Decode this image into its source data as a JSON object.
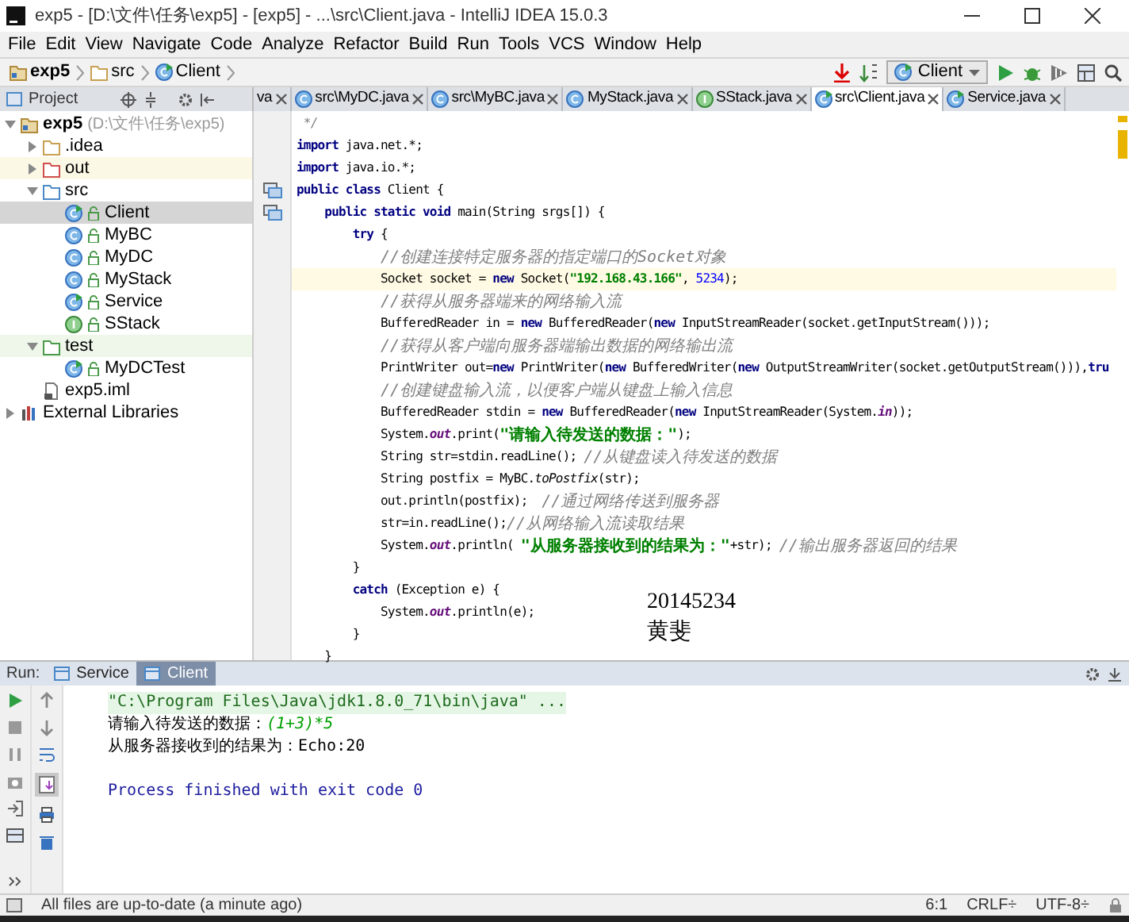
{
  "window": {
    "title": "exp5 - [D:\\文件\\任务\\exp5] - [exp5] - ...\\src\\Client.java - IntelliJ IDEA 15.0.3"
  },
  "menu": [
    "File",
    "Edit",
    "View",
    "Navigate",
    "Code",
    "Analyze",
    "Refactor",
    "Build",
    "Run",
    "Tools",
    "VCS",
    "Window",
    "Help"
  ],
  "breadcrumb": [
    {
      "label": "exp5",
      "kind": "module"
    },
    {
      "label": "src",
      "kind": "folder"
    },
    {
      "label": "Client",
      "kind": "runnable"
    }
  ],
  "run_config": {
    "label": "Client"
  },
  "project_panel": {
    "title": "Project"
  },
  "tabs": [
    {
      "label": "va",
      "selected": false
    },
    {
      "label": "src\\MyDC.java",
      "kind": "class",
      "selected": false
    },
    {
      "label": "src\\MyBC.java",
      "kind": "class",
      "selected": false
    },
    {
      "label": "MyStack.java",
      "kind": "class",
      "selected": false
    },
    {
      "label": "SStack.java",
      "kind": "interface",
      "selected": false
    },
    {
      "label": "src\\Client.java",
      "kind": "runnable",
      "selected": true
    },
    {
      "label": "Service.java",
      "kind": "runnable",
      "selected": false
    }
  ],
  "tree": [
    {
      "label": "exp5",
      "path": "(D:\\文件\\任务\\exp5)",
      "kind": "module",
      "expanded": true,
      "selected": false,
      "children": [
        {
          "label": ".idea",
          "kind": "folder",
          "expanded": false,
          "selected": false
        },
        {
          "label": "out",
          "kind": "excluded",
          "expanded": false,
          "selected": false
        },
        {
          "label": "src",
          "kind": "source",
          "expanded": true,
          "selected": false,
          "children": [
            {
              "label": "Client",
              "kind": "runnable",
              "selected": true
            },
            {
              "label": "MyBC",
              "kind": "class",
              "selected": false
            },
            {
              "label": "MyDC",
              "kind": "class",
              "selected": false
            },
            {
              "label": "MyStack",
              "kind": "class",
              "selected": false
            },
            {
              "label": "Service",
              "kind": "runnable",
              "selected": false
            },
            {
              "label": "SStack",
              "kind": "interface",
              "selected": false
            }
          ]
        },
        {
          "label": "test",
          "kind": "test",
          "expanded": true,
          "selected": false,
          "children": [
            {
              "label": "MyDCTest",
              "kind": "runnable",
              "selected": false
            }
          ]
        },
        {
          "label": "exp5.iml",
          "kind": "file",
          "selected": false
        }
      ]
    },
    {
      "label": "External Libraries",
      "kind": "libraries",
      "expanded": false,
      "selected": false
    }
  ],
  "code": [
    {
      "current": false,
      "tokens": [
        {
          "text": " */",
          "kind": "comment"
        }
      ]
    },
    {
      "current": false,
      "tokens": [
        {
          "text": "import",
          "kind": "keyword"
        },
        {
          "text": " java.net.*;",
          "kind": "plain"
        }
      ]
    },
    {
      "current": false,
      "tokens": [
        {
          "text": "import",
          "kind": "keyword"
        },
        {
          "text": " java.io.*;",
          "kind": "plain"
        }
      ]
    },
    {
      "current": false,
      "marker": true,
      "tokens": [
        {
          "text": "public class",
          "kind": "keyword"
        },
        {
          "text": " Client {",
          "kind": "plain"
        }
      ]
    },
    {
      "current": false,
      "marker": true,
      "tokens": [
        {
          "text": "    public static void",
          "kind": "keyword"
        },
        {
          "text": " main(String srgs[]) {",
          "kind": "plain"
        }
      ]
    },
    {
      "current": false,
      "tokens": [
        {
          "text": "        try",
          "kind": "keyword"
        },
        {
          "text": " {",
          "kind": "plain"
        }
      ]
    },
    {
      "current": false,
      "tokens": [
        {
          "text": "            //创建连接特定服务器的指定端口的Socket对象",
          "kind": "comment"
        }
      ]
    },
    {
      "current": true,
      "tokens": [
        {
          "text": "            Socket socket = ",
          "kind": "plain"
        },
        {
          "text": "new",
          "kind": "keyword"
        },
        {
          "text": " Socket(",
          "kind": "plain"
        },
        {
          "text": "\"192.168.43.166\"",
          "kind": "string"
        },
        {
          "text": ", ",
          "kind": "plain"
        },
        {
          "text": "5234",
          "kind": "number"
        },
        {
          "text": ");",
          "kind": "plain"
        }
      ]
    },
    {
      "current": false,
      "tokens": [
        {
          "text": "            //获得从服务器端来的网络输入流",
          "kind": "comment"
        }
      ]
    },
    {
      "current": false,
      "tokens": [
        {
          "text": "            BufferedReader in = ",
          "kind": "plain"
        },
        {
          "text": "new",
          "kind": "keyword"
        },
        {
          "text": " BufferedReader(",
          "kind": "plain"
        },
        {
          "text": "new",
          "kind": "keyword"
        },
        {
          "text": " InputStreamReader(socket.getInputStream()));",
          "kind": "plain"
        }
      ]
    },
    {
      "current": false,
      "tokens": [
        {
          "text": "            //获得从客户端向服务器端输出数据的网络输出流",
          "kind": "comment"
        }
      ]
    },
    {
      "current": false,
      "tokens": [
        {
          "text": "            PrintWriter out=",
          "kind": "plain"
        },
        {
          "text": "new",
          "kind": "keyword"
        },
        {
          "text": " PrintWriter(",
          "kind": "plain"
        },
        {
          "text": "new",
          "kind": "keyword"
        },
        {
          "text": " BufferedWriter(",
          "kind": "plain"
        },
        {
          "text": "new",
          "kind": "keyword"
        },
        {
          "text": " OutputStreamWriter(socket.getOutputStream())),",
          "kind": "plain"
        },
        {
          "text": "tru",
          "kind": "keyword"
        }
      ]
    },
    {
      "current": false,
      "tokens": [
        {
          "text": "            //创建键盘输入流，以便客户端从键盘上输入信息",
          "kind": "comment"
        }
      ]
    },
    {
      "current": false,
      "tokens": [
        {
          "text": "            BufferedReader stdin = ",
          "kind": "plain"
        },
        {
          "text": "new",
          "kind": "keyword"
        },
        {
          "text": " BufferedReader(",
          "kind": "plain"
        },
        {
          "text": "new",
          "kind": "keyword"
        },
        {
          "text": " InputStreamReader(System.",
          "kind": "plain"
        },
        {
          "text": "in",
          "kind": "static"
        },
        {
          "text": "));",
          "kind": "plain"
        }
      ]
    },
    {
      "current": false,
      "tokens": [
        {
          "text": "            System.",
          "kind": "plain"
        },
        {
          "text": "out",
          "kind": "static"
        },
        {
          "text": ".print(",
          "kind": "plain"
        },
        {
          "text": "\"请输入待发送的数据：\"",
          "kind": "string"
        },
        {
          "text": ");",
          "kind": "plain"
        }
      ]
    },
    {
      "current": false,
      "tokens": [
        {
          "text": "            String str=stdin.readLine(); ",
          "kind": "plain"
        },
        {
          "text": "//从键盘读入待发送的数据",
          "kind": "comment"
        }
      ]
    },
    {
      "current": false,
      "tokens": [
        {
          "text": "            String postfix = MyBC.",
          "kind": "plain"
        },
        {
          "text": "toPostfix",
          "kind": "static_method"
        },
        {
          "text": "(str);",
          "kind": "plain"
        }
      ]
    },
    {
      "current": false,
      "tokens": [
        {
          "text": "            out.println(postfix);  ",
          "kind": "plain"
        },
        {
          "text": "//通过网络传送到服务器",
          "kind": "comment"
        }
      ]
    },
    {
      "current": false,
      "tokens": [
        {
          "text": "            str=in.readLine();",
          "kind": "plain"
        },
        {
          "text": "//从网络输入流读取结果",
          "kind": "comment"
        }
      ]
    },
    {
      "current": false,
      "tokens": [
        {
          "text": "            System.",
          "kind": "plain"
        },
        {
          "text": "out",
          "kind": "static"
        },
        {
          "text": ".println( ",
          "kind": "plain"
        },
        {
          "text": "\"从服务器接收到的结果为：\"",
          "kind": "string"
        },
        {
          "text": "+str); ",
          "kind": "plain"
        },
        {
          "text": "//输出服务器返回的结果",
          "kind": "comment"
        }
      ]
    },
    {
      "current": false,
      "tokens": [
        {
          "text": "        }",
          "kind": "plain"
        }
      ]
    },
    {
      "current": false,
      "tokens": [
        {
          "text": "        catch",
          "kind": "keyword"
        },
        {
          "text": " (Exception e) {",
          "kind": "plain"
        }
      ]
    },
    {
      "current": false,
      "tokens": [
        {
          "text": "            System.",
          "kind": "plain"
        },
        {
          "text": "out",
          "kind": "static"
        },
        {
          "text": ".println(e);",
          "kind": "plain"
        }
      ]
    },
    {
      "current": false,
      "tokens": [
        {
          "text": "        }",
          "kind": "plain"
        }
      ]
    },
    {
      "current": false,
      "tokens": [
        {
          "text": "    }",
          "kind": "plain"
        }
      ]
    }
  ],
  "annotation": [
    "20145234",
    "黄斐"
  ],
  "run_panel": {
    "label": "Run:",
    "tabs": [
      {
        "label": "Service",
        "selected": false
      },
      {
        "label": "Client",
        "selected": true
      }
    ],
    "console": [
      {
        "kind": "command",
        "segments": [
          {
            "text": "\"C:\\Program Files\\Java\\jdk1.8.0_71\\bin\\java\" ...",
            "kind": "plain"
          }
        ]
      },
      {
        "kind": "output",
        "segments": [
          {
            "text": "请输入待发送的数据：",
            "kind": "plain"
          },
          {
            "text": "(1+3)*5",
            "kind": "input"
          }
        ]
      },
      {
        "kind": "output",
        "segments": [
          {
            "text": "从服务器接收到的结果为：Echo:20",
            "kind": "plain"
          }
        ]
      },
      {
        "kind": "blank"
      },
      {
        "kind": "system",
        "segments": [
          {
            "text": "Process finished with exit code 0",
            "kind": "plain"
          }
        ]
      }
    ]
  },
  "status_bar": {
    "message": "All files are up-to-date (a minute ago)",
    "position": "6:1",
    "line_separator": "CRLF÷",
    "encoding": "UTF-8÷"
  }
}
